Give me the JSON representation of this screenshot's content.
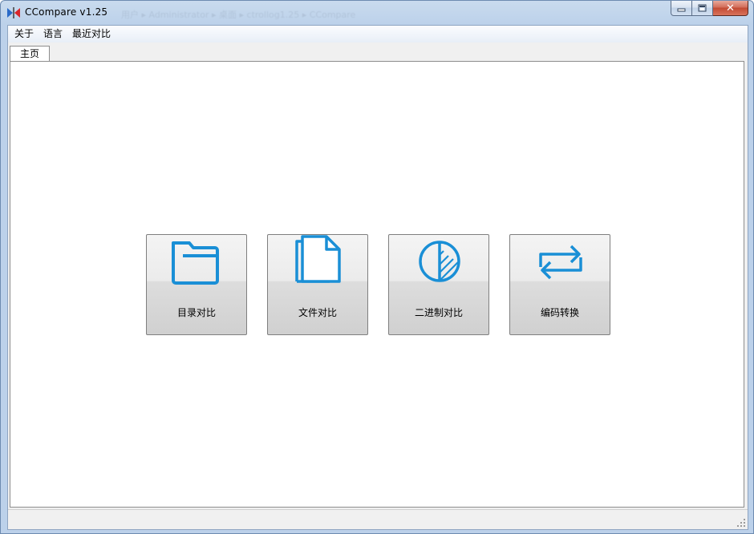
{
  "window": {
    "title": "CCompare  v1.25",
    "background_ghost_text": "用户 ▸ Administrator ▸ 桌面 ▸ ctrollog1.25 ▸ CCompare",
    "controls": {
      "minimize_icon": "minimize-icon",
      "maximize_icon": "maximize-icon",
      "close_icon": "close-icon"
    }
  },
  "menu": {
    "items": [
      {
        "label": "关于"
      },
      {
        "label": "语言"
      },
      {
        "label": "最近对比"
      }
    ]
  },
  "tabs": [
    {
      "label": "主页",
      "active": true
    }
  ],
  "home": {
    "tiles": [
      {
        "label": "目录对比",
        "icon": "folder-icon"
      },
      {
        "label": "文件对比",
        "icon": "files-icon"
      },
      {
        "label": "二进制对比",
        "icon": "binary-compare-icon"
      },
      {
        "label": "编码转换",
        "icon": "convert-arrows-icon"
      }
    ]
  },
  "colors": {
    "icon_blue": "#1a8fd6",
    "title_bar": "#bcd1ea",
    "close_red": "#c24a33"
  }
}
